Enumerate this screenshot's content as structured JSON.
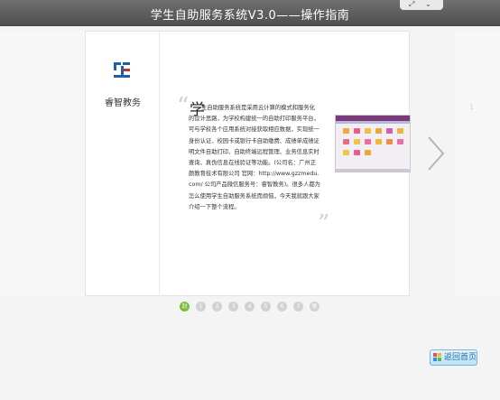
{
  "window": {
    "title": "学生自助服务系统V3.0——操作指南"
  },
  "controls": {
    "expand_icon": "expand-icon",
    "collapse_icon": "chevron-down-icon"
  },
  "slide": {
    "brand_name": "睿智教务",
    "lead_char": "学",
    "body_text": "生自助服务系统是采用云计算的模式和服务化的设计思路，为学校构建统一的自助打印服务平台，可与学校各个应用系统对接获取相应数据，实现统一身份认证、校园卡或银行卡自助缴费、成绩单成绩证明文件自助打印、自助终端远程管理、业务信息实时查询、真伪信息在线验证等功能。(公司名：广州正颜教育技术有限公司 官网：http://www.gzzmedu.com/ 公司产品微信服务号：睿智教务)。很多人都为怎么使用学生自助服务系统而烦恼，今天我就跟大家介绍一下整个流程。",
    "quote_open": "“",
    "quote_close": "”",
    "screenshot_icon": "app-screenshot-thumbnail"
  },
  "ghost_next": {
    "lead_text": "1"
  },
  "pager": {
    "pages": [
      "封",
      "1",
      "2",
      "3",
      "4",
      "5",
      "6",
      "7",
      "尾"
    ],
    "active_index": 0
  },
  "home_button": {
    "label": "返回首页"
  },
  "colors": {
    "active_dot": "#7bbf3d",
    "titlebar": "#5a5a5a",
    "logo_blue": "#1f5fa6",
    "logo_red": "#c8342a"
  }
}
